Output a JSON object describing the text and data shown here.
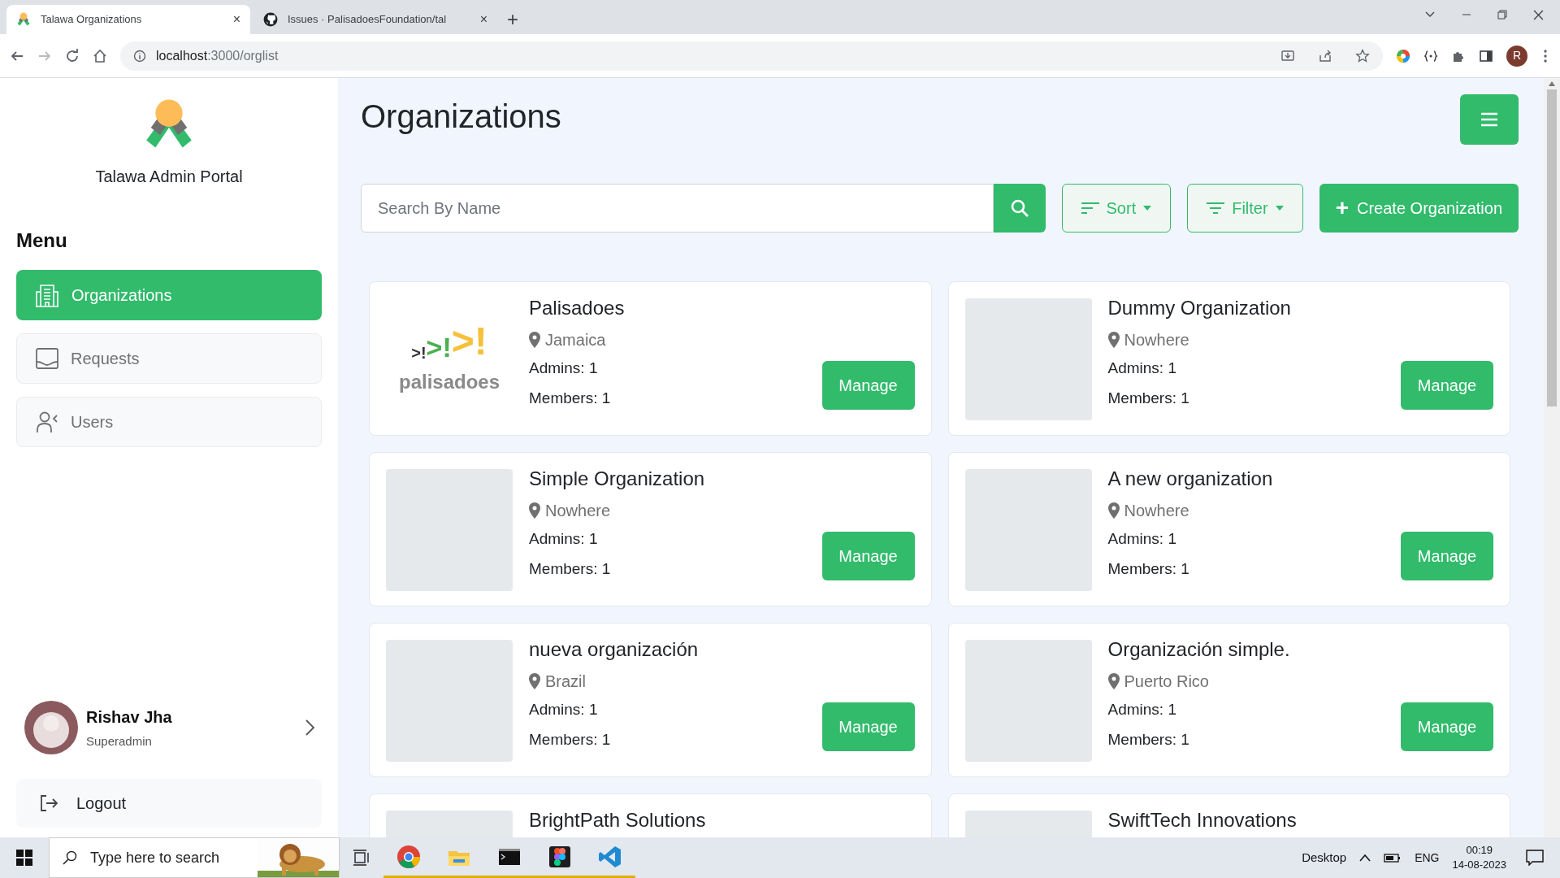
{
  "browser": {
    "tabs": [
      {
        "title": "Talawa Organizations",
        "close": "×",
        "selected": true
      },
      {
        "title": "Issues · PalisadoesFoundation/tal",
        "close": "×",
        "selected": false
      }
    ],
    "new_tab": "+",
    "url_host": "localhost",
    "url_path": ":3000/orglist",
    "profile_initial": "R"
  },
  "sidebar": {
    "brand": "Talawa Admin Portal",
    "menu_title": "Menu",
    "items": [
      {
        "label": "Organizations",
        "selected": true
      },
      {
        "label": "Requests",
        "selected": false
      },
      {
        "label": "Users",
        "selected": false
      }
    ],
    "user": {
      "name": "Rishav Jha",
      "role": "Superadmin"
    },
    "logout": "Logout"
  },
  "main": {
    "title": "Organizations",
    "search": {
      "placeholder": "Search By Name"
    },
    "sort_label": "Sort",
    "filter_label": "Filter",
    "create_label": "Create Organization",
    "create_icon": "+",
    "organizations": [
      {
        "name": "Palisadoes",
        "location": "Jamaica",
        "admins": "Admins: 1",
        "members": "Members: 1",
        "manage": "Manage",
        "logo": {
          "marks": [
            {
              "text": ">!",
              "color": "#333333"
            },
            {
              "text": ">!",
              "color": "#4caf50"
            },
            {
              "text": ">!",
              "color": "#f5c13b"
            }
          ],
          "name": "palisadoes"
        }
      },
      {
        "name": "Dummy Organization",
        "location": "Nowhere",
        "admins": "Admins: 1",
        "members": "Members: 1",
        "manage": "Manage"
      },
      {
        "name": "Simple Organization",
        "location": "Nowhere",
        "admins": "Admins: 1",
        "members": "Members: 1",
        "manage": "Manage"
      },
      {
        "name": "A new organization",
        "location": "Nowhere",
        "admins": "Admins: 1",
        "members": "Members: 1",
        "manage": "Manage"
      },
      {
        "name": "nueva organización",
        "location": "Brazil",
        "admins": "Admins: 1",
        "members": "Members: 1",
        "manage": "Manage"
      },
      {
        "name": "Organización simple.",
        "location": "Puerto Rico",
        "admins": "Admins: 1",
        "members": "Members: 1",
        "manage": "Manage"
      },
      {
        "name": "BrightPath Solutions"
      },
      {
        "name": "SwiftTech Innovations"
      }
    ]
  },
  "taskbar": {
    "search_placeholder": "Type here to search",
    "desktop": "Desktop",
    "language": "ENG",
    "time": "00:19",
    "date": "14-08-2023"
  }
}
